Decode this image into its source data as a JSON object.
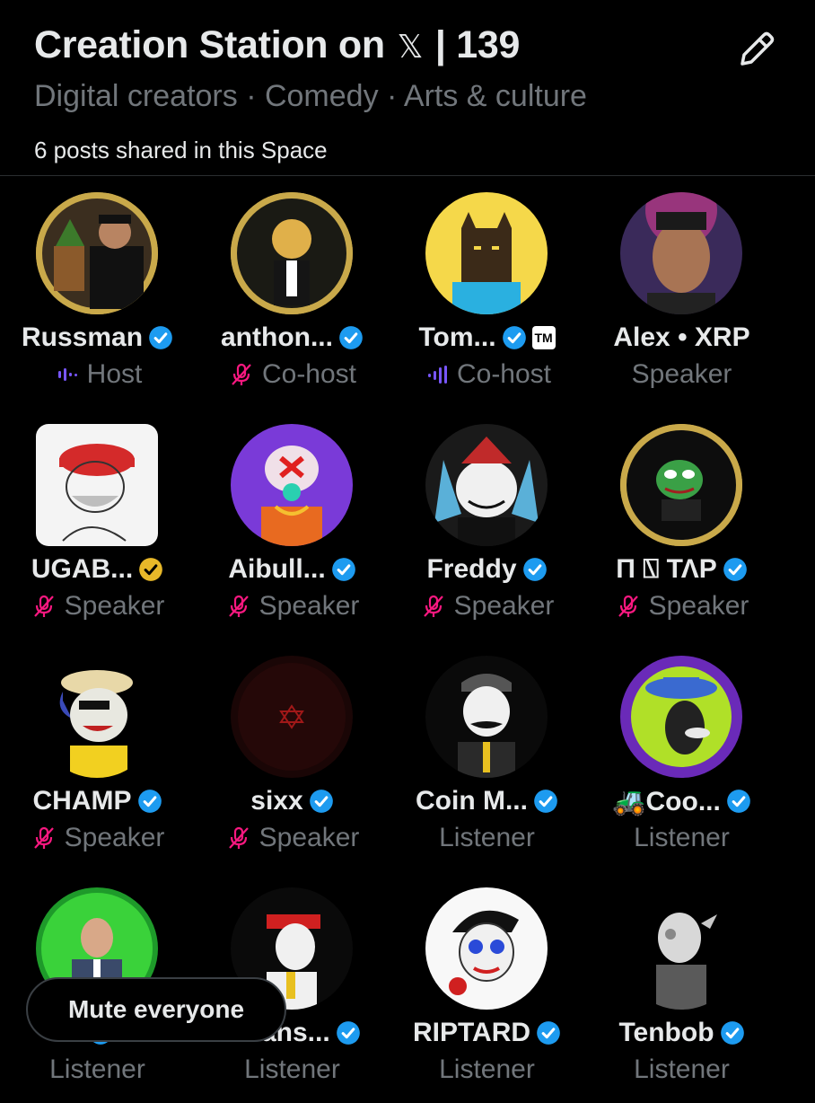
{
  "space": {
    "title": "Creation Station on",
    "x_logo": "𝕏",
    "listener_count": "| 139",
    "topics": "Digital creators · Comedy · Arts & culture",
    "posts_shared": "6 posts shared in this Space"
  },
  "colors": {
    "background": "#000000",
    "primary_text": "#e7e9ea",
    "secondary_text": "#71767b",
    "verified_blue": "#1d9bf0",
    "verified_gold": "#e8b829",
    "muted_pink": "#f91880",
    "speaking_purple": "#7856ff"
  },
  "participants": [
    {
      "name": "Russman",
      "badge": "verified-blue",
      "role": "Host",
      "status": "speaking"
    },
    {
      "name": "anthon...",
      "badge": "verified-blue",
      "role": "Co-host",
      "status": "muted"
    },
    {
      "name": "Tom...",
      "badge": "verified-blue",
      "affiliate_badge": "TM",
      "role": "Co-host",
      "status": "speaking"
    },
    {
      "name": "Alex • XRP",
      "badge": "",
      "role": "Speaker",
      "status": "none"
    },
    {
      "name": "UGAB...",
      "badge": "verified-gold",
      "role": "Speaker",
      "status": "muted"
    },
    {
      "name": "Aibull...",
      "badge": "verified-blue",
      "role": "Speaker",
      "status": "muted"
    },
    {
      "name": "Freddy",
      "badge": "verified-blue",
      "role": "Speaker",
      "status": "muted"
    },
    {
      "name": "Π ⍂ ΤΛΡ",
      "badge": "verified-blue",
      "role": "Speaker",
      "status": "muted"
    },
    {
      "name": "CHAMP",
      "badge": "verified-blue",
      "role": "Speaker",
      "status": "muted"
    },
    {
      "name": "sixx",
      "badge": "verified-blue",
      "role": "Speaker",
      "status": "muted"
    },
    {
      "name": "Coin M...",
      "badge": "verified-blue",
      "role": "Listener",
      "status": "none"
    },
    {
      "name": "🚜Coo...",
      "badge": "verified-blue",
      "role": "Listener",
      "status": "none"
    },
    {
      "name": "",
      "badge": "verified-blue",
      "role": "Listener",
      "status": "none"
    },
    {
      "name": "...Jans...",
      "badge": "verified-blue",
      "role": "Listener",
      "status": "none"
    },
    {
      "name": "RIPTARD",
      "badge": "verified-blue",
      "role": "Listener",
      "status": "none"
    },
    {
      "name": "Tenbob",
      "badge": "verified-blue",
      "role": "Listener",
      "status": "none"
    }
  ],
  "actions": {
    "mute_everyone": "Mute everyone"
  }
}
